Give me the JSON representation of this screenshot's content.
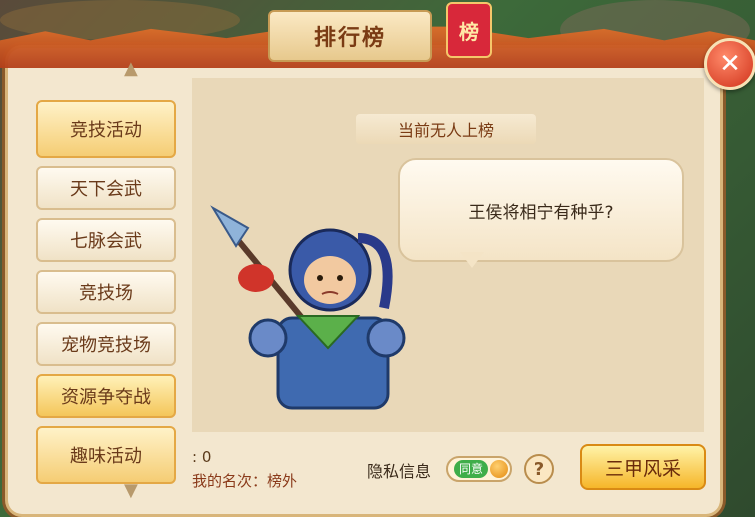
{
  "window": {
    "title": "排行榜",
    "seal_text": "榜",
    "close_label": "✕"
  },
  "sidebar": {
    "items": [
      {
        "label": "竞技活动",
        "kind": "category"
      },
      {
        "label": "天下会武",
        "kind": "item"
      },
      {
        "label": "七脉会武",
        "kind": "item"
      },
      {
        "label": "竞技场",
        "kind": "item"
      },
      {
        "label": "宠物竞技场",
        "kind": "item"
      },
      {
        "label": "资源争夺战",
        "kind": "item-active"
      },
      {
        "label": "趣味活动",
        "kind": "category"
      }
    ]
  },
  "main": {
    "notice": "当前无人上榜",
    "speech": "王侯将相宁有种乎?"
  },
  "footer": {
    "score_line": ": 0",
    "rank_line": "我的名次：榜外",
    "privacy_label": "隐私信息",
    "toggle_text": "同意",
    "help_label": "?",
    "primary_button": "三甲风采"
  },
  "colors": {
    "accent": "#f6b629",
    "banner": "#c9521f",
    "panel": "#e9d8b8"
  }
}
